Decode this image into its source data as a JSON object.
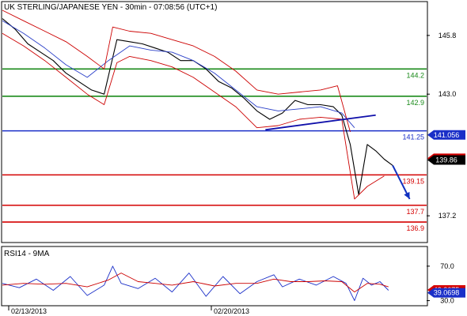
{
  "chart_data": {
    "type": "line",
    "title": "UK STERLING/JAPANESE YEN - 30min - 07:08:56 (UTC+1)",
    "price_panel": {
      "ylim": [
        136.0,
        147.0
      ],
      "y_ticks": [
        {
          "value": 145.8,
          "label": "145.8"
        },
        {
          "value": 143.0,
          "label": "143.0"
        },
        {
          "value": 137.2,
          "label": "137.2"
        }
      ],
      "x_ticks": [
        {
          "x": 0.0,
          "label": "02/13/2013"
        },
        {
          "x": 0.5,
          "label": "02/20/2013"
        }
      ],
      "series": [
        {
          "color": "#000000",
          "x": [
            0.0,
            0.03,
            0.06,
            0.09,
            0.12,
            0.15,
            0.18,
            0.21,
            0.24,
            0.27,
            0.3,
            0.33,
            0.36,
            0.39,
            0.42,
            0.45,
            0.48,
            0.51,
            0.54,
            0.57,
            0.6,
            0.63,
            0.66,
            0.69,
            0.72,
            0.75,
            0.78,
            0.8,
            0.82,
            0.84,
            0.86,
            0.88,
            0.9,
            0.92
          ],
          "y": [
            146.6,
            146.1,
            145.4,
            145.0,
            144.6,
            144.0,
            143.6,
            143.2,
            143.0,
            145.6,
            145.5,
            145.4,
            145.2,
            145.0,
            144.6,
            144.6,
            144.2,
            143.6,
            143.3,
            142.8,
            142.2,
            141.8,
            142.1,
            142.7,
            142.5,
            142.5,
            142.4,
            142.0,
            140.6,
            138.2,
            140.6,
            140.3,
            139.9,
            139.6
          ]
        },
        {
          "color": "#2a3fc8",
          "x": [
            0.0,
            0.05,
            0.1,
            0.15,
            0.2,
            0.25,
            0.3,
            0.35,
            0.4,
            0.45,
            0.5,
            0.55,
            0.6,
            0.65,
            0.7,
            0.75,
            0.8,
            0.83
          ],
          "y": [
            146.5,
            145.9,
            145.2,
            144.4,
            143.8,
            144.6,
            145.3,
            145.1,
            145.0,
            144.6,
            144.0,
            143.2,
            142.4,
            142.2,
            142.3,
            142.4,
            142.1,
            141.4
          ]
        },
        {
          "color": "#cc0000",
          "x": [
            0.0,
            0.05,
            0.1,
            0.15,
            0.2,
            0.24,
            0.26,
            0.3,
            0.35,
            0.4,
            0.45,
            0.5,
            0.55,
            0.6,
            0.65,
            0.7,
            0.75,
            0.79,
            0.82
          ],
          "y": [
            147.0,
            146.5,
            146.0,
            145.5,
            144.8,
            144.2,
            146.2,
            146.0,
            145.9,
            145.6,
            145.3,
            144.8,
            144.1,
            143.2,
            143.0,
            143.1,
            143.2,
            143.4,
            141.2
          ]
        },
        {
          "color": "#cc0000",
          "x": [
            0.0,
            0.05,
            0.1,
            0.15,
            0.2,
            0.24,
            0.27,
            0.3,
            0.35,
            0.4,
            0.45,
            0.5,
            0.55,
            0.6,
            0.65,
            0.7,
            0.75,
            0.8,
            0.83,
            0.86,
            0.9
          ],
          "y": [
            145.9,
            145.3,
            144.6,
            143.8,
            143.0,
            142.5,
            144.5,
            144.8,
            144.6,
            144.3,
            143.8,
            143.1,
            142.4,
            141.4,
            141.5,
            141.8,
            141.9,
            141.8,
            138.0,
            138.6,
            139.1
          ]
        }
      ],
      "trendline": {
        "color": "#1010aa",
        "x": [
          0.62,
          0.88
        ],
        "y": [
          141.3,
          142.0
        ]
      },
      "arrow": {
        "color": "#1030c0",
        "from": [
          0.92,
          139.6
        ],
        "to": [
          0.96,
          138.0
        ]
      },
      "horizontal_levels": [
        {
          "value": 144.2,
          "label": "144.2",
          "color": "#1a8a1a"
        },
        {
          "value": 142.9,
          "label": "142.9",
          "color": "#1a8a1a"
        },
        {
          "value": 141.25,
          "label": "141.25",
          "color": "#1a2fc8"
        },
        {
          "value": 139.15,
          "label": "139.15",
          "color": "#d40000"
        },
        {
          "value": 137.7,
          "label": "137.7",
          "color": "#d40000"
        },
        {
          "value": 136.9,
          "label": "136.9",
          "color": "#d40000"
        }
      ],
      "badges": [
        {
          "value": 141.056,
          "label": "141.056",
          "color": "#1a2fc8"
        },
        {
          "value": 139.941,
          "label": "139.941",
          "color": "#d40000"
        },
        {
          "value": 139.86,
          "label": "139.86",
          "color": "#000000"
        }
      ]
    },
    "rsi_panel": {
      "title": "RSI14 - 9MA",
      "ylim": [
        25,
        80
      ],
      "y_ticks": [
        {
          "value": 70.0,
          "label": "70.0"
        },
        {
          "value": 30.0,
          "label": "30.0"
        }
      ],
      "series": [
        {
          "color": "#1a2fc8",
          "x": [
            0.0,
            0.04,
            0.08,
            0.12,
            0.16,
            0.2,
            0.24,
            0.26,
            0.28,
            0.32,
            0.36,
            0.4,
            0.44,
            0.48,
            0.52,
            0.56,
            0.6,
            0.64,
            0.66,
            0.7,
            0.74,
            0.78,
            0.81,
            0.83,
            0.85,
            0.87,
            0.89,
            0.91
          ],
          "y": [
            50,
            45,
            55,
            42,
            58,
            36,
            48,
            70,
            50,
            44,
            56,
            40,
            62,
            35,
            58,
            38,
            52,
            60,
            46,
            55,
            48,
            58,
            50,
            30,
            56,
            48,
            52,
            42
          ]
        },
        {
          "color": "#cc0000",
          "x": [
            0.0,
            0.05,
            0.1,
            0.15,
            0.2,
            0.25,
            0.28,
            0.32,
            0.36,
            0.4,
            0.45,
            0.5,
            0.55,
            0.6,
            0.64,
            0.68,
            0.72,
            0.76,
            0.8,
            0.83,
            0.86,
            0.89,
            0.91
          ],
          "y": [
            48,
            50,
            49,
            50,
            46,
            54,
            62,
            52,
            50,
            48,
            52,
            47,
            50,
            50,
            55,
            52,
            52,
            53,
            52,
            40,
            50,
            49,
            46
          ]
        }
      ],
      "badges": [
        {
          "value": 42.3675,
          "label": "42.3675",
          "color": "#d40000"
        },
        {
          "value": 39.0698,
          "label": "39.0698",
          "color": "#1a2fc8"
        }
      ]
    }
  }
}
